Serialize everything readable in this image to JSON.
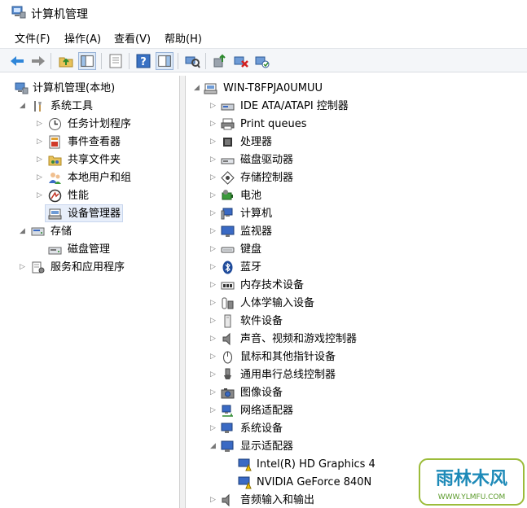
{
  "window": {
    "title": "计算机管理"
  },
  "menu": {
    "items": [
      "文件(F)",
      "操作(A)",
      "查看(V)",
      "帮助(H)"
    ]
  },
  "left_tree": {
    "root": "计算机管理(本地)",
    "system_tools": "系统工具",
    "task_scheduler": "任务计划程序",
    "event_viewer": "事件查看器",
    "shared_folders": "共享文件夹",
    "local_users": "本地用户和组",
    "performance": "性能",
    "device_manager": "设备管理器",
    "storage": "存储",
    "disk_management": "磁盘管理",
    "services_apps": "服务和应用程序"
  },
  "right_tree": {
    "root": "WIN-T8FPJA0UMUU",
    "categories": [
      "IDE ATA/ATAPI 控制器",
      "Print queues",
      "处理器",
      "磁盘驱动器",
      "存储控制器",
      "电池",
      "计算机",
      "监视器",
      "键盘",
      "蓝牙",
      "内存技术设备",
      "人体学输入设备",
      "软件设备",
      "声音、视频和游戏控制器",
      "鼠标和其他指针设备",
      "通用串行总线控制器",
      "图像设备",
      "网络适配器",
      "系统设备",
      "显示适配器"
    ],
    "display_children": [
      "Intel(R) HD Graphics 4",
      "NVIDIA GeForce 840N"
    ],
    "last_category": "音频输入和输出"
  },
  "watermark": {
    "text": "雨林木风",
    "url": "WWW.YLMFU.COM"
  },
  "colors": {
    "accent": "#1e6fd9",
    "selection": "#e7eefa",
    "warning": "#f5c400"
  }
}
